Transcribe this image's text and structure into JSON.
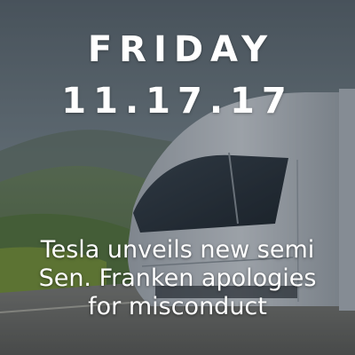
{
  "date": {
    "weekday": "FRIDAY",
    "date_text": "11.17.17"
  },
  "headlines": [
    "Tesla unveils new semi",
    "Sen. Franken apologies",
    "for misconduct"
  ],
  "colors": {
    "text": "#ffffff",
    "sky": "#7e8c93",
    "hills": "#5d7a4f",
    "road": "#8f8f8a",
    "truck_body": "#c9ced4"
  }
}
